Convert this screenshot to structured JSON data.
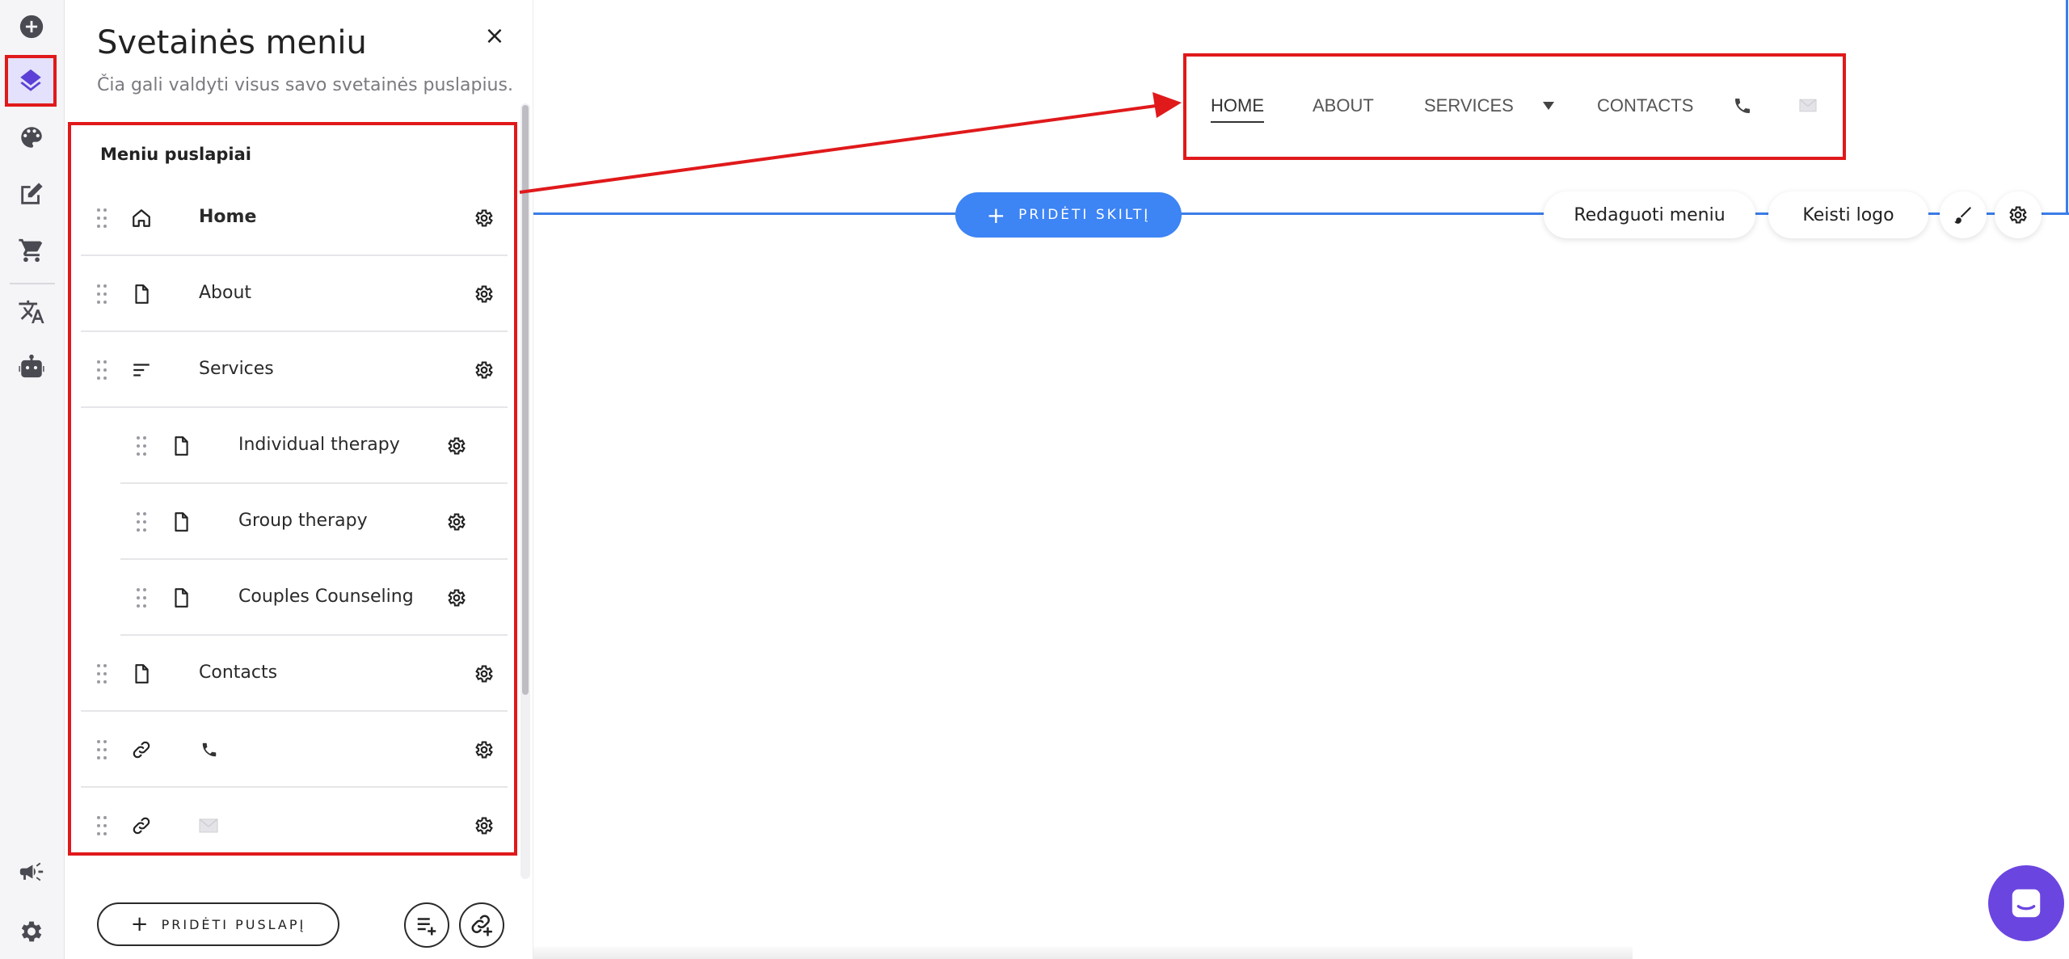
{
  "rail": {
    "items": [
      {
        "icon": "add-circle-icon"
      },
      {
        "icon": "layers-icon",
        "active": true
      },
      {
        "icon": "palette-icon"
      },
      {
        "icon": "edit-icon"
      },
      {
        "icon": "cart-icon"
      },
      {
        "icon": "translate-icon"
      },
      {
        "icon": "robot-icon"
      },
      {
        "icon": "megaphone-icon"
      },
      {
        "icon": "settings-icon"
      }
    ]
  },
  "panel": {
    "title": "Svetainės meniu",
    "subtitle": "Čia gali valdyti visus savo svetainės puslapius.",
    "close_label": "×",
    "menu_heading": "Meniu puslapiai",
    "items": [
      {
        "label": "Home",
        "icon": "home-icon",
        "bold": true
      },
      {
        "label": "About",
        "icon": "page-icon"
      },
      {
        "label": "Services",
        "icon": "submenu-icon"
      },
      {
        "label": "Individual therapy",
        "icon": "page-icon",
        "child": true
      },
      {
        "label": "Group therapy",
        "icon": "page-icon",
        "child": true
      },
      {
        "label": "Couples Counseling",
        "icon": "page-icon",
        "child": true
      },
      {
        "label": "Contacts",
        "icon": "page-icon"
      },
      {
        "label": "",
        "icon": "link-icon",
        "glyph": "phone-icon"
      },
      {
        "label": "",
        "icon": "link-icon",
        "glyph": "mail-icon"
      }
    ],
    "add_page_label": "PRIDĖTI PUSLAPĮ",
    "add_page_plus": "+"
  },
  "canvas": {
    "add_section_label": "PRIDĖTI SKILTĮ",
    "add_section_plus": "+",
    "edit_menu_label": "Redaguoti meniu",
    "change_logo_label": "Keisti logo",
    "nav": {
      "items": [
        "HOME",
        "ABOUT",
        "SERVICES",
        "CONTACTS"
      ],
      "active": "HOME"
    }
  },
  "colors": {
    "accent_blue": "#3d84f4",
    "highlight_red": "#e0191b",
    "brand_purple": "#6b45e0"
  }
}
